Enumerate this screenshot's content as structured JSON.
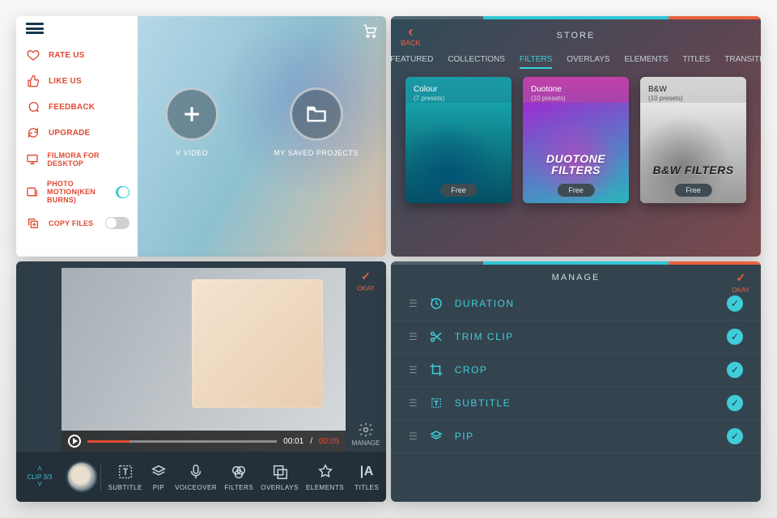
{
  "home": {
    "menu": [
      {
        "icon": "heart-icon",
        "label": "RATE US"
      },
      {
        "icon": "thumbs-up-icon",
        "label": "LIKE US"
      },
      {
        "icon": "speech-icon",
        "label": "FEEDBACK"
      },
      {
        "icon": "refresh-icon",
        "label": "UPGRADE"
      },
      {
        "icon": "desktop-icon",
        "label": "FILMORA FOR DESKTOP"
      },
      {
        "icon": "photo-motion-icon",
        "label": "PHOTO MOTION(KEN BURNS)",
        "toggle": true,
        "on": true
      },
      {
        "icon": "copy-icon",
        "label": "COPY FILES",
        "toggle": true,
        "on": false
      }
    ],
    "action_new": "V VIDEO",
    "action_saved": "MY SAVED PROJECTS"
  },
  "store": {
    "back_label": "BACK",
    "title": "STORE",
    "tabs": [
      "FEATURED",
      "COLLECTIONS",
      "FILTERS",
      "OVERLAYS",
      "ELEMENTS",
      "TITLES",
      "TRANSITI"
    ],
    "active_tab": "FILTERS",
    "packs": [
      {
        "name": "Colour",
        "presets": "(7 presets)",
        "price": "Free",
        "big": ""
      },
      {
        "name": "Duotone",
        "presets": "(10 presets)",
        "price": "Free",
        "big": "DUOTONE FILTERS"
      },
      {
        "name": "B&W",
        "presets": "(10 presets)",
        "price": "Free",
        "big": "B&W FILTERS"
      }
    ]
  },
  "editor": {
    "okay": "OKAY",
    "manage": "MANAGE",
    "clip_counter": "CLIP 3/3",
    "time_cur": "00:01",
    "time_sep": "/",
    "time_total": "00:05",
    "tools": [
      "SUBTITLE",
      "PIP",
      "VOICEOVER",
      "FILTERS",
      "OVERLAYS",
      "ELEMENTS",
      "TITLES"
    ]
  },
  "manage": {
    "title": "MANAGE",
    "okay": "OKAY",
    "rows": [
      {
        "icon": "duration-icon",
        "label": "DURATION"
      },
      {
        "icon": "trim-icon",
        "label": "TRIM CLIP"
      },
      {
        "icon": "crop-icon",
        "label": "CROP"
      },
      {
        "icon": "subtitle-icon",
        "label": "SUBTITLE"
      },
      {
        "icon": "pip-icon",
        "label": "PIP"
      }
    ]
  }
}
